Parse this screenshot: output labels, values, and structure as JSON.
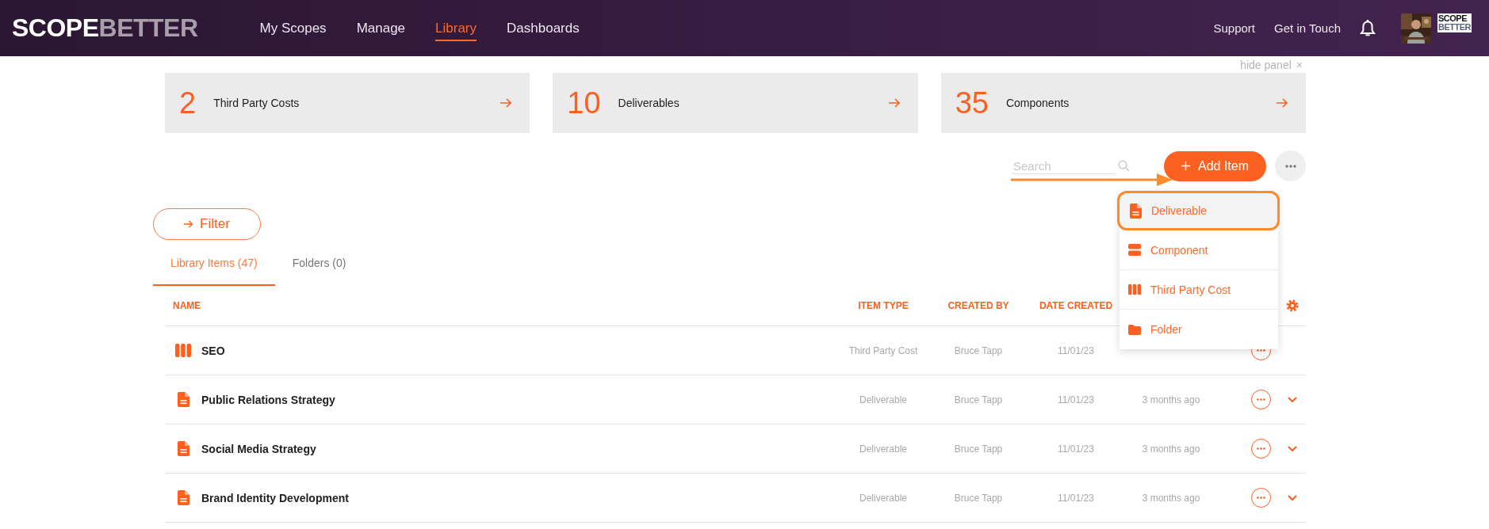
{
  "header": {
    "logo": {
      "primary": "SCOPE",
      "secondary": "BETTER"
    },
    "nav": [
      {
        "label": "My Scopes",
        "selected": false
      },
      {
        "label": "Manage",
        "selected": false
      },
      {
        "label": "Library",
        "selected": true
      },
      {
        "label": "Dashboards",
        "selected": false
      }
    ],
    "links": [
      "Support",
      "Get in Touch"
    ],
    "account_logo": {
      "line_1": "SCOPE",
      "line_2": "BETTER"
    }
  },
  "panel": {
    "hide_label": "hide panel",
    "close_glyph": "×"
  },
  "stats": [
    {
      "count": "2",
      "label": "Third Party Costs"
    },
    {
      "count": "10",
      "label": "Deliverables"
    },
    {
      "count": "35",
      "label": "Components"
    }
  ],
  "toolbar": {
    "search": {
      "placeholder": "Search"
    },
    "add_button": "Add Item",
    "pointer_arrow": true
  },
  "add_menu": {
    "items": [
      {
        "kind": "deliverable",
        "label": "Deliverable",
        "highlighted": true
      },
      {
        "kind": "component",
        "label": "Component",
        "highlighted": false
      },
      {
        "kind": "third_party_cost",
        "label": "Third Party Cost",
        "highlighted": false
      },
      {
        "kind": "folder",
        "label": "Folder",
        "highlighted": false
      }
    ]
  },
  "filter": {
    "label": "Filter"
  },
  "tabs": [
    {
      "label": "Library Items (47)",
      "selected": true
    },
    {
      "label": "Folders (0)",
      "selected": false
    }
  ],
  "table": {
    "columns": [
      "NAME",
      "ITEM TYPE",
      "CREATED BY",
      "DATE CREATED"
    ],
    "rows": [
      {
        "kind": "third_party_cost",
        "name": "SEO",
        "item_type": "Third Party Cost",
        "created_by": "Bruce Tapp",
        "date_created": "11/01/23",
        "expandable": false
      },
      {
        "kind": "deliverable",
        "name": "Public Relations Strategy",
        "item_type": "Deliverable",
        "created_by": "Bruce Tapp",
        "date_created": "11/01/23",
        "modified": "3 months ago",
        "expandable": true
      },
      {
        "kind": "deliverable",
        "name": "Social Media Strategy",
        "item_type": "Deliverable",
        "created_by": "Bruce Tapp",
        "date_created": "11/01/23",
        "modified": "3 months ago",
        "expandable": true
      },
      {
        "kind": "deliverable",
        "name": "Brand Identity Development",
        "item_type": "Deliverable",
        "created_by": "Bruce Tapp",
        "date_created": "11/01/23",
        "modified": "3 months ago",
        "expandable": true
      }
    ]
  }
}
